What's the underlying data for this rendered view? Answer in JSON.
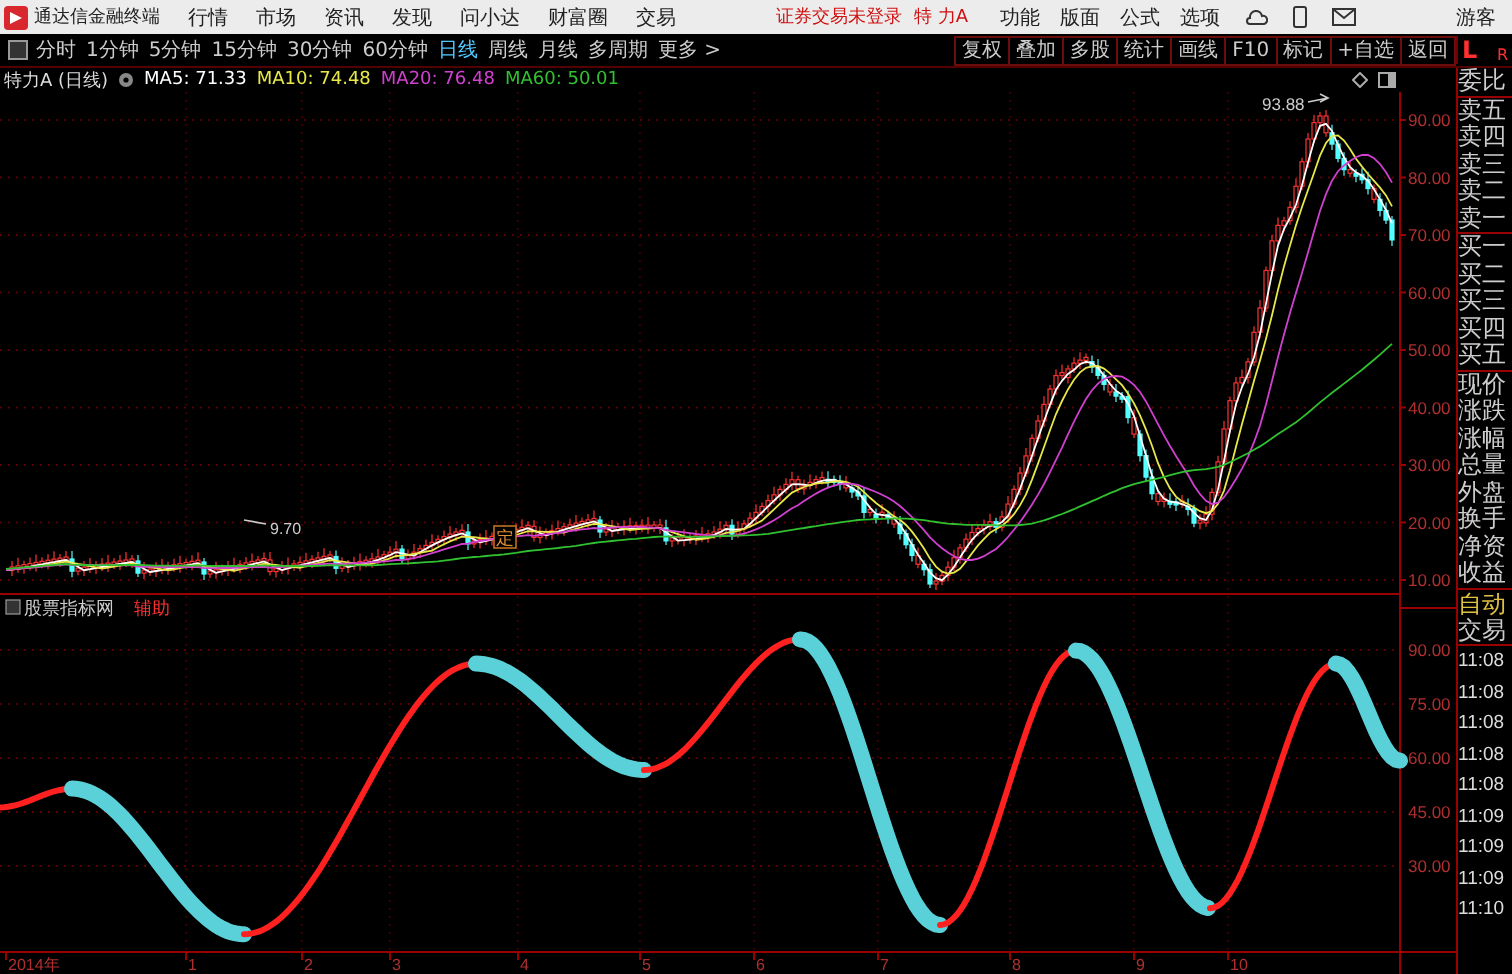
{
  "menu_bar": {
    "app_title": "通达信金融终端",
    "menus": [
      "行情",
      "市场",
      "资讯",
      "发现",
      "问小达",
      "财富圈",
      "交易"
    ],
    "login_status": "证券交易未登录",
    "stock": "特 力A",
    "tools": [
      "功能",
      "版面",
      "公式",
      "选项"
    ],
    "user": "游客"
  },
  "period_tabs": [
    {
      "label": "分时",
      "selected": false
    },
    {
      "label": "1分钟",
      "selected": false
    },
    {
      "label": "5分钟",
      "selected": false
    },
    {
      "label": "15分钟",
      "selected": false
    },
    {
      "label": "30分钟",
      "selected": false
    },
    {
      "label": "60分钟",
      "selected": false
    },
    {
      "label": "日线",
      "selected": true
    },
    {
      "label": "周线",
      "selected": false
    },
    {
      "label": "月线",
      "selected": false
    },
    {
      "label": "多周期",
      "selected": false
    },
    {
      "label": "更多 >",
      "selected": false
    }
  ],
  "toolbar_buttons": [
    "复权",
    "叠加",
    "多股",
    "统计",
    "画线",
    "F10",
    "标记",
    "+自选",
    "返回"
  ],
  "corner": {
    "left": "L",
    "right": "R"
  },
  "chart_header": {
    "stock": "特力A (日线)",
    "indicators": [
      {
        "label": "MA5: 71.33",
        "color": "#ffffff"
      },
      {
        "label": "MA10: 74.48",
        "color": "#e8e84a"
      },
      {
        "label": "MA20: 76.48",
        "color": "#d040d0"
      },
      {
        "label": "MA60: 50.01",
        "color": "#30c030"
      }
    ]
  },
  "price_axis": [
    "90.00",
    "80.00",
    "70.00",
    "60.00",
    "50.00",
    "40.00",
    "30.00",
    "20.00",
    "10.00"
  ],
  "annotations": {
    "high": "93.88",
    "low": "9.70",
    "marker": "定"
  },
  "indicator_panel": {
    "name": "股票指标网",
    "tag": "辅助",
    "axis": [
      "90.00",
      "75.00",
      "60.00",
      "45.00",
      "30.00"
    ]
  },
  "time_axis": [
    "2014年",
    "1",
    "2",
    "3",
    "4",
    "5",
    "6",
    "7",
    "8",
    "9",
    "10"
  ],
  "sidebar": {
    "groups": [
      [
        {
          "text": "委比",
          "kind": "label"
        }
      ],
      [
        {
          "text": "卖五",
          "kind": "label"
        },
        {
          "text": "卖四",
          "kind": "label"
        },
        {
          "text": "卖三",
          "kind": "label"
        },
        {
          "text": "卖二",
          "kind": "label"
        },
        {
          "text": "卖一",
          "kind": "label"
        }
      ],
      [
        {
          "text": "买一",
          "kind": "label"
        },
        {
          "text": "买二",
          "kind": "label"
        },
        {
          "text": "买三",
          "kind": "label"
        },
        {
          "text": "买四",
          "kind": "label"
        },
        {
          "text": "买五",
          "kind": "label"
        }
      ],
      [
        {
          "text": "现价",
          "kind": "label"
        },
        {
          "text": "涨跌",
          "kind": "label"
        },
        {
          "text": "涨幅",
          "kind": "label"
        },
        {
          "text": "总量",
          "kind": "label"
        },
        {
          "text": "外盘",
          "kind": "label"
        },
        {
          "text": "换手",
          "kind": "label"
        },
        {
          "text": "净资",
          "kind": "label"
        },
        {
          "text": "收益",
          "kind": "label"
        }
      ],
      [
        {
          "text": "自动",
          "kind": "status"
        },
        {
          "text": "交易",
          "kind": "label"
        }
      ],
      [
        {
          "text": "11:08",
          "kind": "time"
        },
        {
          "text": "11:08",
          "kind": "time"
        },
        {
          "text": "11:08",
          "kind": "time"
        },
        {
          "text": "11:08",
          "kind": "time"
        },
        {
          "text": "11:08",
          "kind": "time"
        },
        {
          "text": "11:09",
          "kind": "time"
        },
        {
          "text": "11:09",
          "kind": "time"
        },
        {
          "text": "11:09",
          "kind": "time"
        },
        {
          "text": "11:10",
          "kind": "time"
        }
      ]
    ]
  }
}
